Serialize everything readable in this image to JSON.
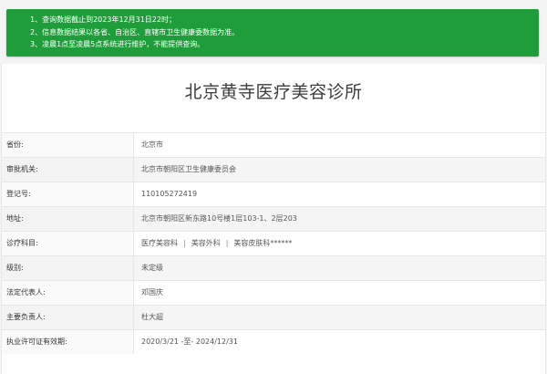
{
  "notice": {
    "lines": [
      "1、查询数据截止到2023年12月31日22时；",
      "2、信息数据结果以各省、自治区、直辖市卫生健康委数据为准。",
      "3、凌晨1点至凌晨5点系统进行维护，不能提供查询。"
    ],
    "background_color": "#1f9d3a"
  },
  "title": "北京黄寺医疗美容诊所",
  "fields": {
    "province": {
      "label": "省份:",
      "value": "北京市"
    },
    "authority": {
      "label": "审批机关:",
      "value": "北京市朝阳区卫生健康委员会"
    },
    "reg_no": {
      "label": "登记号:",
      "value": "110105272419"
    },
    "address": {
      "label": "地址:",
      "value": "北京市朝阳区新东路10号楼1层103-1、2层203"
    },
    "departments": {
      "label": "诊疗科目:",
      "items": [
        "医疗美容科",
        "美容外科",
        "美容皮肤科******"
      ]
    },
    "level": {
      "label": "级别:",
      "value": "未定级"
    },
    "legal_rep": {
      "label": "法定代表人:",
      "value": "邓国庆"
    },
    "principal": {
      "label": "主要负责人:",
      "value": "杜大超"
    },
    "license_period": {
      "label": "执业许可证有效期:",
      "value": "2020/3/21 -至- 2024/12/31"
    }
  }
}
